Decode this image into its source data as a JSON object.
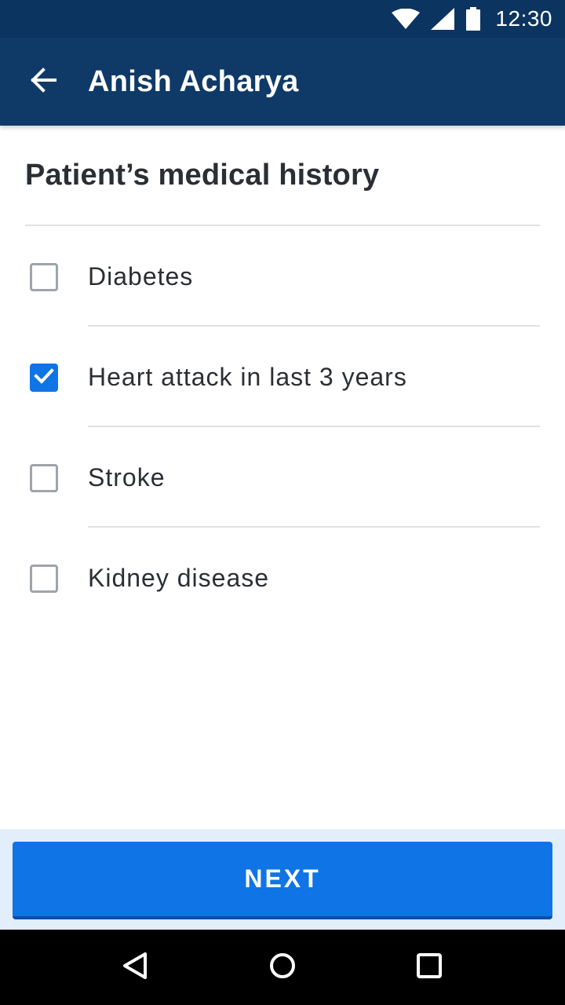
{
  "status_bar": {
    "time": "12:30",
    "icons": [
      "wifi-icon",
      "signal-icon",
      "battery-icon"
    ]
  },
  "app_bar": {
    "back_icon": "arrow-left-icon",
    "title": "Anish Acharya"
  },
  "section": {
    "title": "Patient’s medical history"
  },
  "items": [
    {
      "label": "Diabetes",
      "checked": false
    },
    {
      "label": "Heart attack in last 3 years",
      "checked": true
    },
    {
      "label": "Stroke",
      "checked": false
    },
    {
      "label": "Kidney disease",
      "checked": false
    }
  ],
  "action": {
    "next_label": "NEXT"
  },
  "nav_bar": {
    "icons": [
      "back-triangle-icon",
      "home-circle-icon",
      "recents-square-icon"
    ]
  },
  "colors": {
    "status_bar_bg": "#0c3460",
    "app_bar_bg": "#0f3a68",
    "accent": "#0f74e6",
    "action_area_bg": "#e3eefb"
  }
}
